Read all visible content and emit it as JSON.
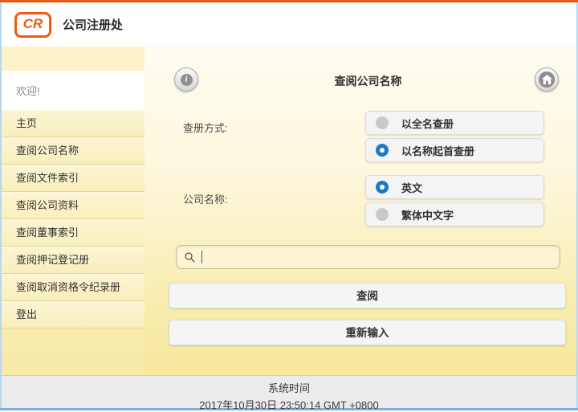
{
  "header": {
    "logo_text": "CR",
    "app_title": "公司注册处"
  },
  "sidebar": {
    "welcome": "欢迎!",
    "items": [
      {
        "label": "主页"
      },
      {
        "label": "查阅公司名称"
      },
      {
        "label": "查阅文件索引"
      },
      {
        "label": "查阅公司资料"
      },
      {
        "label": "查阅董事索引"
      },
      {
        "label": "查阅押记登记册"
      },
      {
        "label": "查阅取消资格令纪录册"
      },
      {
        "label": "登出"
      }
    ]
  },
  "main": {
    "title": "查阅公司名称",
    "icons": {
      "info": "info-circle",
      "home": "house",
      "search": "magnifier"
    },
    "search_mode": {
      "label": "查册方式:",
      "options": [
        {
          "label": "以全名查册",
          "selected": false
        },
        {
          "label": "以名称起首查册",
          "selected": true
        }
      ]
    },
    "company_name": {
      "label": "公司名称:",
      "options": [
        {
          "label": "英文",
          "selected": true
        },
        {
          "label": "繁体中文字",
          "selected": false
        }
      ]
    },
    "search_input": {
      "value": "",
      "placeholder": ""
    },
    "buttons": {
      "search": "查阅",
      "reset": "重新输入"
    }
  },
  "footer": {
    "label": "系统时间",
    "datetime": "2017年10月30日 23:50:14 GMT +0800"
  },
  "colors": {
    "accent_orange": "#e8590c",
    "radio_selected_blue": "#1b7ac6",
    "side_border_blue": "#b9d7ee",
    "bottom_border_blue": "#79aede",
    "footer_gray": "#ececec"
  }
}
